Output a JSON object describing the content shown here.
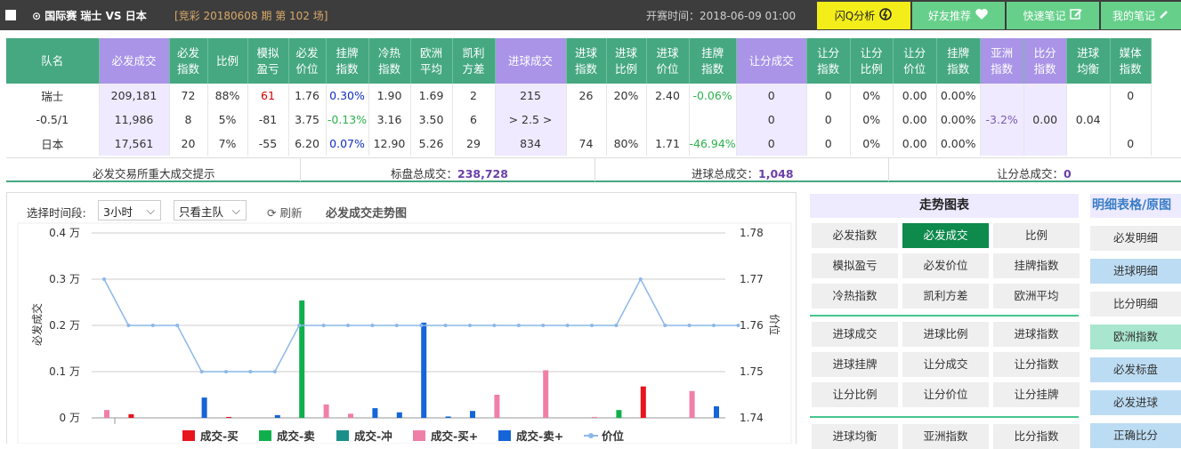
{
  "topbar": {
    "match": "⊙ 国际赛  瑞士  VS 日本",
    "lottery": "[竞彩 20180608 期 第 102 场]",
    "start_time": "开赛时间：2018-06-09 01:00",
    "buttons": [
      "闪Q分析",
      "好友推荐",
      "快速笔记",
      "我的笔记"
    ]
  },
  "table": {
    "headers": [
      {
        "l1": "队名",
        "l2": "",
        "purple": false
      },
      {
        "l1": "必发成交",
        "l2": "",
        "purple": true
      },
      {
        "l1": "必发",
        "l2": "指数",
        "purple": false
      },
      {
        "l1": "比例",
        "l2": "",
        "purple": false
      },
      {
        "l1": "模拟",
        "l2": "盈亏",
        "purple": false
      },
      {
        "l1": "必发",
        "l2": "价位",
        "purple": false
      },
      {
        "l1": "挂牌",
        "l2": "指数",
        "purple": false
      },
      {
        "l1": "冷热",
        "l2": "指数",
        "purple": false
      },
      {
        "l1": "欧洲",
        "l2": "平均",
        "purple": false
      },
      {
        "l1": "凯利",
        "l2": "方差",
        "purple": false
      },
      {
        "l1": "进球成交",
        "l2": "",
        "purple": true
      },
      {
        "l1": "进球",
        "l2": "指数",
        "purple": false
      },
      {
        "l1": "进球",
        "l2": "比例",
        "purple": false
      },
      {
        "l1": "进球",
        "l2": "价位",
        "purple": false
      },
      {
        "l1": "挂牌",
        "l2": "指数",
        "purple": false
      },
      {
        "l1": "让分成交",
        "l2": "",
        "purple": true
      },
      {
        "l1": "让分",
        "l2": "指数",
        "purple": false
      },
      {
        "l1": "让分",
        "l2": "比例",
        "purple": false
      },
      {
        "l1": "让分",
        "l2": "价位",
        "purple": false
      },
      {
        "l1": "挂牌",
        "l2": "指数",
        "purple": false
      },
      {
        "l1": "亚洲",
        "l2": "指数",
        "purple": true
      },
      {
        "l1": "比分",
        "l2": "指数",
        "purple": true
      },
      {
        "l1": "进球",
        "l2": "均衡",
        "purple": false
      },
      {
        "l1": "媒体",
        "l2": "指数",
        "purple": false
      }
    ],
    "rows": [
      [
        "瑞士",
        "209,181",
        "72",
        "88%",
        "61",
        "1.76",
        "0.30%",
        "1.90",
        "1.69",
        "2",
        "215",
        "26",
        "20%",
        "2.40",
        "-0.06%",
        "0",
        "0",
        "0%",
        "0.00",
        "0.00%",
        "",
        "",
        "",
        "0"
      ],
      [
        "-0.5/1",
        "11,986",
        "8",
        "5%",
        "-81",
        "3.75",
        "-0.13%",
        "3.16",
        "3.50",
        "6",
        "> 2.5 >",
        "",
        "",
        "",
        "",
        "0",
        "0",
        "0%",
        "0.00",
        "0.00%",
        "-3.2%",
        "0.00",
        "0.04",
        ""
      ],
      [
        "日本",
        "17,561",
        "20",
        "7%",
        "-55",
        "6.20",
        "0.07%",
        "12.90",
        "5.26",
        "29",
        "834",
        "74",
        "80%",
        "1.71",
        "-46.94%",
        "0",
        "0",
        "0%",
        "0.00",
        "0.00%",
        "",
        "",
        "",
        "0"
      ]
    ]
  },
  "summary": {
    "hint": "必发交易所重大成交提示",
    "total_label": "标盘总成交：",
    "total_value": "238,728",
    "goal_label": "进球总成交：",
    "goal_value": "1,048",
    "handicap_label": "让分总成交：",
    "handicap_value": "0"
  },
  "chart_controls": {
    "period_label": "选择时间段:",
    "period_value": "3小时",
    "team_value": "只看主队",
    "refresh": "刷新",
    "title": "必发成交走势图"
  },
  "chart_data": {
    "type": "bar",
    "ylabel_left": "必发成交",
    "ylabel_right": "价位",
    "left_ticks": [
      "0 万",
      "0.1 万",
      "0.2 万",
      "0.3 万",
      "0.4 万"
    ],
    "right_ticks": [
      "1.74",
      "1.75",
      "1.76",
      "1.77",
      "1.78"
    ],
    "ylim_left": [
      0,
      0.4
    ],
    "ylim_right": [
      1.74,
      1.78
    ],
    "legend": [
      "成交-买",
      "成交-卖",
      "成交-冲",
      "成交-买+",
      "成交-卖+",
      "价位"
    ],
    "colors": {
      "buy": "#e8141e",
      "sell": "#0fb04c",
      "hedge": "#1a8f8a",
      "buyplus": "#f07fa8",
      "sellplus": "#1565d8",
      "price": "#8cb8e8"
    },
    "bars": [
      {
        "i": 0,
        "series": "buyplus",
        "value": 0.017
      },
      {
        "i": 1,
        "series": "buy",
        "value": 0.008
      },
      {
        "i": 4,
        "series": "sellplus",
        "value": 0.044
      },
      {
        "i": 5,
        "series": "buy",
        "value": 0.002
      },
      {
        "i": 7,
        "series": "sellplus",
        "value": 0.006
      },
      {
        "i": 8,
        "series": "sell",
        "value": 0.254
      },
      {
        "i": 9,
        "series": "buyplus",
        "value": 0.029
      },
      {
        "i": 10,
        "series": "buyplus",
        "value": 0.009
      },
      {
        "i": 11,
        "series": "sellplus",
        "value": 0.021
      },
      {
        "i": 12,
        "series": "sellplus",
        "value": 0.012
      },
      {
        "i": 13,
        "series": "sellplus",
        "value": 0.206
      },
      {
        "i": 14,
        "series": "sellplus",
        "value": 0.003
      },
      {
        "i": 15,
        "series": "sellplus",
        "value": 0.015
      },
      {
        "i": 16,
        "series": "buyplus",
        "value": 0.05
      },
      {
        "i": 18,
        "series": "buyplus",
        "value": 0.103
      },
      {
        "i": 20,
        "series": "buyplus",
        "value": 0.002
      },
      {
        "i": 21,
        "series": "sell",
        "value": 0.017
      },
      {
        "i": 22,
        "series": "buy",
        "value": 0.068
      },
      {
        "i": 24,
        "series": "buyplus",
        "value": 0.058
      },
      {
        "i": 25,
        "series": "sellplus",
        "value": 0.025
      }
    ],
    "price": [
      1.77,
      1.76,
      1.76,
      1.76,
      1.75,
      1.75,
      1.75,
      1.75,
      1.76,
      1.76,
      1.76,
      1.76,
      1.76,
      1.76,
      1.76,
      1.76,
      1.76,
      1.76,
      1.76,
      1.76,
      1.76,
      1.76,
      1.77,
      1.76,
      1.76,
      1.76,
      1.76
    ]
  },
  "trend_panel": {
    "title": "走势图表",
    "group1": [
      "必发指数",
      "必发成交",
      "比例",
      "模拟盈亏",
      "必发价位",
      "挂牌指数",
      "冷热指数",
      "凯利方差",
      "欧洲平均"
    ],
    "group2": [
      "进球成交",
      "进球比例",
      "进球指数",
      "进球挂牌",
      "让分成交",
      "让分指数",
      "让分比例",
      "让分价位",
      "让分挂牌"
    ],
    "group3": [
      "进球均衡",
      "亚洲指数",
      "比分指数"
    ]
  },
  "detail_panel": {
    "title": "明细表格/原图",
    "items": [
      "必发明细",
      "进球明细",
      "比分明细",
      "欧洲指数",
      "必发标盘",
      "必发进球",
      "正确比分"
    ]
  }
}
